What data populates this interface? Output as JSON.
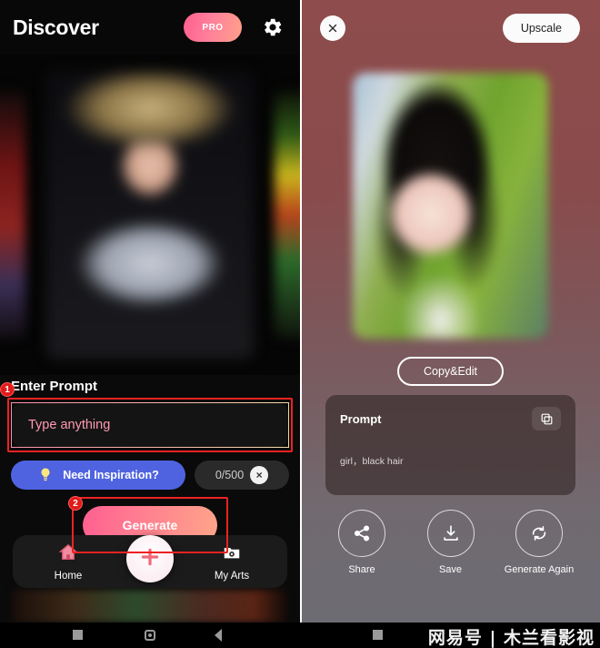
{
  "left_panel": {
    "header": {
      "title": "Discover",
      "pro_label": "PRO",
      "settings_icon": "gear-icon"
    },
    "carousel": {
      "items": [
        {
          "name": "art-card-previous",
          "description": "blurred red anime artwork"
        },
        {
          "name": "art-card-current",
          "description": "blurred anime boy in navy cap and grey uniform"
        },
        {
          "name": "art-card-next",
          "description": "blurred colorful anime artwork"
        }
      ]
    },
    "prompt_section": {
      "label": "Enter Prompt",
      "step_badge": "1",
      "input_placeholder": "Type anything",
      "input_value": "",
      "inspiration_label": "Need Inspiration?",
      "inspiration_icon": "lightbulb-icon",
      "counter": "0/500",
      "clear_icon": "close-icon"
    },
    "generate": {
      "label": "Generate",
      "step_badge": "2"
    },
    "nav": {
      "items": [
        {
          "label": "Home",
          "icon": "home-icon"
        },
        {
          "label": "My Arts",
          "icon": "folder-photo-icon"
        }
      ],
      "fab_icon": "plus-icon"
    }
  },
  "right_panel": {
    "header": {
      "close_icon": "close-icon",
      "upscale_label": "Upscale"
    },
    "result": {
      "description": "blurred anime girl with black hair outdoors"
    },
    "copy_edit_label": "Copy&Edit",
    "prompt_card": {
      "title": "Prompt",
      "text": "girl，black hair",
      "copy_icon": "copy-icon"
    },
    "actions": [
      {
        "label": "Share",
        "icon": "share-icon"
      },
      {
        "label": "Save",
        "icon": "download-icon"
      },
      {
        "label": "Generate Again",
        "icon": "refresh-icon"
      }
    ]
  },
  "system_bar": {
    "buttons": [
      {
        "name": "recents-button",
        "icon": "square-icon"
      },
      {
        "name": "home-button",
        "icon": "circle-icon"
      },
      {
        "name": "back-button",
        "icon": "back-triangle-icon"
      }
    ],
    "watermark": "网易号 | 木兰看影视"
  },
  "colors": {
    "accent_pink": "#ff5f8f",
    "accent_orange": "#ffa589",
    "badge_red": "#e01b1b",
    "annotation_red": "#ee2222",
    "inspiration_blue": "#4f63e0",
    "right_bg_top": "#8e4c4c",
    "right_bg_bottom": "#6d6c73"
  }
}
